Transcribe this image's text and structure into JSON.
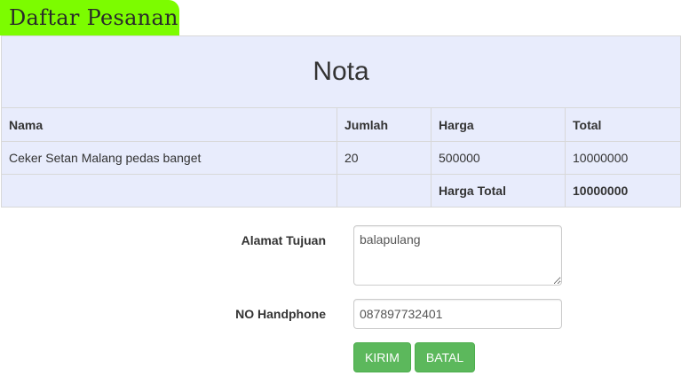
{
  "page": {
    "title": "Daftar Pesanan",
    "accent_color": "#7cfc00"
  },
  "nota": {
    "caption": "Nota",
    "table_bg": "#e8ecfc",
    "headers": [
      "Nama",
      "Jumlah",
      "Harga",
      "Total"
    ],
    "rows": [
      [
        "Ceker Setan Malang pedas banget",
        "20",
        "500000",
        "10000000"
      ]
    ],
    "total_label": "Harga Total",
    "total_value": "10000000"
  },
  "form": {
    "alamat_label": "Alamat Tujuan",
    "alamat_value": "balapulang",
    "hp_label": "NO Handphone",
    "hp_value": "087897732401",
    "submit_label": "KIRIM",
    "cancel_label": "BATAL",
    "button_color": "#5cb85c"
  }
}
